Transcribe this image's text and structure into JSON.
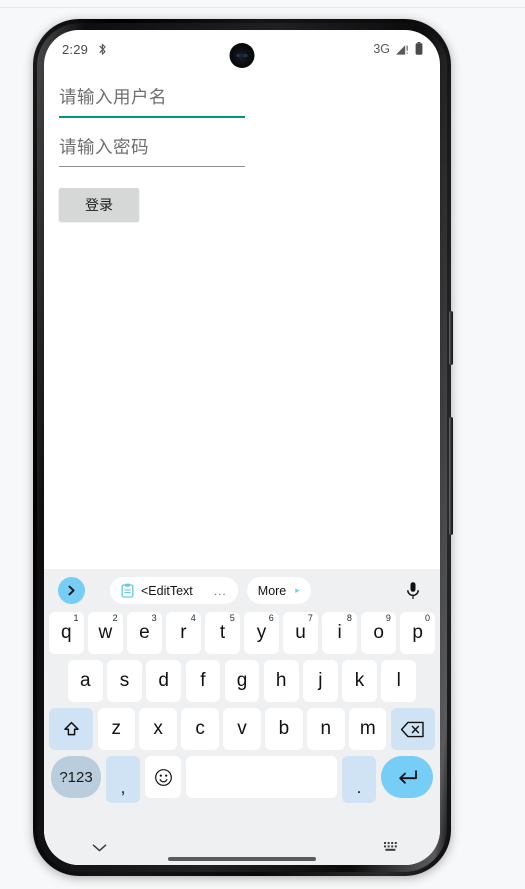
{
  "status_bar": {
    "time": "2:29",
    "bluetooth_icon": "bluetooth-icon",
    "network_label": "3G",
    "signal_icon": "signal-triangle-warning-icon",
    "battery_icon": "battery-full-icon"
  },
  "app": {
    "username_field": {
      "placeholder": "请输入用户名",
      "value": "",
      "focused": true,
      "underline_color": "#00967d"
    },
    "password_field": {
      "placeholder": "请输入密码",
      "value": "",
      "focused": false,
      "underline_color": "#8d8d8d"
    },
    "login_button": {
      "label": "登录",
      "background": "#d6d7d7"
    }
  },
  "keyboard": {
    "toolbar": {
      "expand_icon": "chevron-right-icon",
      "expand_bg": "#76cdf5",
      "suggestion_chip": {
        "icon": "clipboard-icon",
        "label": "<EditText",
        "ellipsis": "..."
      },
      "more_chip": {
        "label": "More",
        "caret": "▸"
      },
      "mic_icon": "microphone-icon"
    },
    "row1": [
      {
        "label": "q",
        "hint": "1"
      },
      {
        "label": "w",
        "hint": "2"
      },
      {
        "label": "e",
        "hint": "3"
      },
      {
        "label": "r",
        "hint": "4"
      },
      {
        "label": "t",
        "hint": "5"
      },
      {
        "label": "y",
        "hint": "6"
      },
      {
        "label": "u",
        "hint": "7"
      },
      {
        "label": "i",
        "hint": "8"
      },
      {
        "label": "o",
        "hint": "9"
      },
      {
        "label": "p",
        "hint": "0"
      }
    ],
    "row2": [
      {
        "label": "a"
      },
      {
        "label": "s"
      },
      {
        "label": "d"
      },
      {
        "label": "f"
      },
      {
        "label": "g"
      },
      {
        "label": "h"
      },
      {
        "label": "j"
      },
      {
        "label": "k"
      },
      {
        "label": "l"
      }
    ],
    "row3": [
      {
        "label": "z"
      },
      {
        "label": "x"
      },
      {
        "label": "c"
      },
      {
        "label": "v"
      },
      {
        "label": "b"
      },
      {
        "label": "n"
      },
      {
        "label": "m"
      }
    ],
    "shift_key": {
      "icon": "shift-arrow-up-icon",
      "background": "#cfe3f5"
    },
    "backspace_key": {
      "icon": "backspace-delete-icon",
      "background": "#cfe3f5"
    },
    "bottom_row": {
      "symbols_key": "?123",
      "comma_key": ",",
      "emoji_key": "☺",
      "space_key": "",
      "period_key": ".",
      "enter_key_icon": "enter-return-icon",
      "enter_key_background": "#76cdf5"
    },
    "background": "#eef0f2"
  },
  "nav_bar": {
    "hide_keyboard_icon": "chevron-down-icon",
    "keyboard_switch_icon": "keyboard-switcher-icon",
    "home_indicator": "home-indicator-pill"
  }
}
